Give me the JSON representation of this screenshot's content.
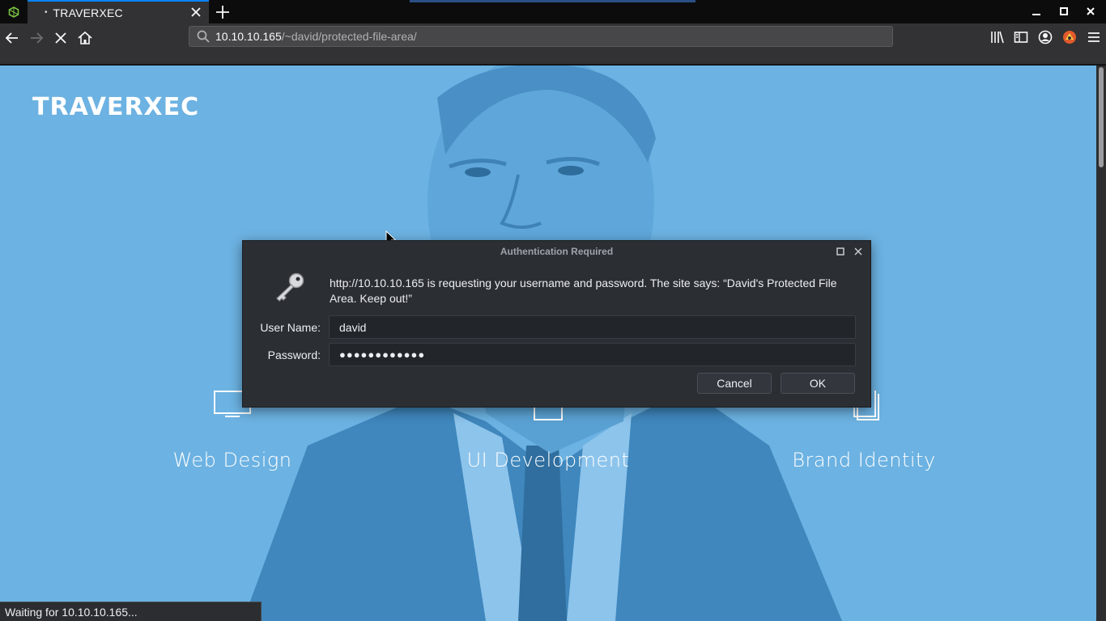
{
  "browser": {
    "tab": {
      "title": "TRAVERXEC",
      "indicator": "•"
    },
    "url": {
      "host": "10.10.10.165",
      "path": "/~david/protected-file-area/"
    },
    "status": "Waiting for 10.10.10.165..."
  },
  "page": {
    "brand": "TRAVERXEC",
    "services": [
      {
        "label": "Web Design",
        "icon": "monitor-icon"
      },
      {
        "label": "UI Development",
        "icon": "document-icon"
      },
      {
        "label": "Brand Identity",
        "icon": "stacked-pages-icon"
      }
    ]
  },
  "dialog": {
    "title": "Authentication Required",
    "message": "http://10.10.10.165 is requesting your username and password. The site says: “David's Protected File Area. Keep out!”",
    "username_label": "User Name:",
    "username_value": "david",
    "password_label": "Password:",
    "password_value": "●●●●●●●●●●●●",
    "cancel_label": "Cancel",
    "ok_label": "OK"
  },
  "colors": {
    "page_background": "#6cb2e2",
    "chrome_dark": "#0c0c0d",
    "toolbar": "#323234",
    "dialog_background": "#2b2e33",
    "accent": "#0a84ff"
  }
}
